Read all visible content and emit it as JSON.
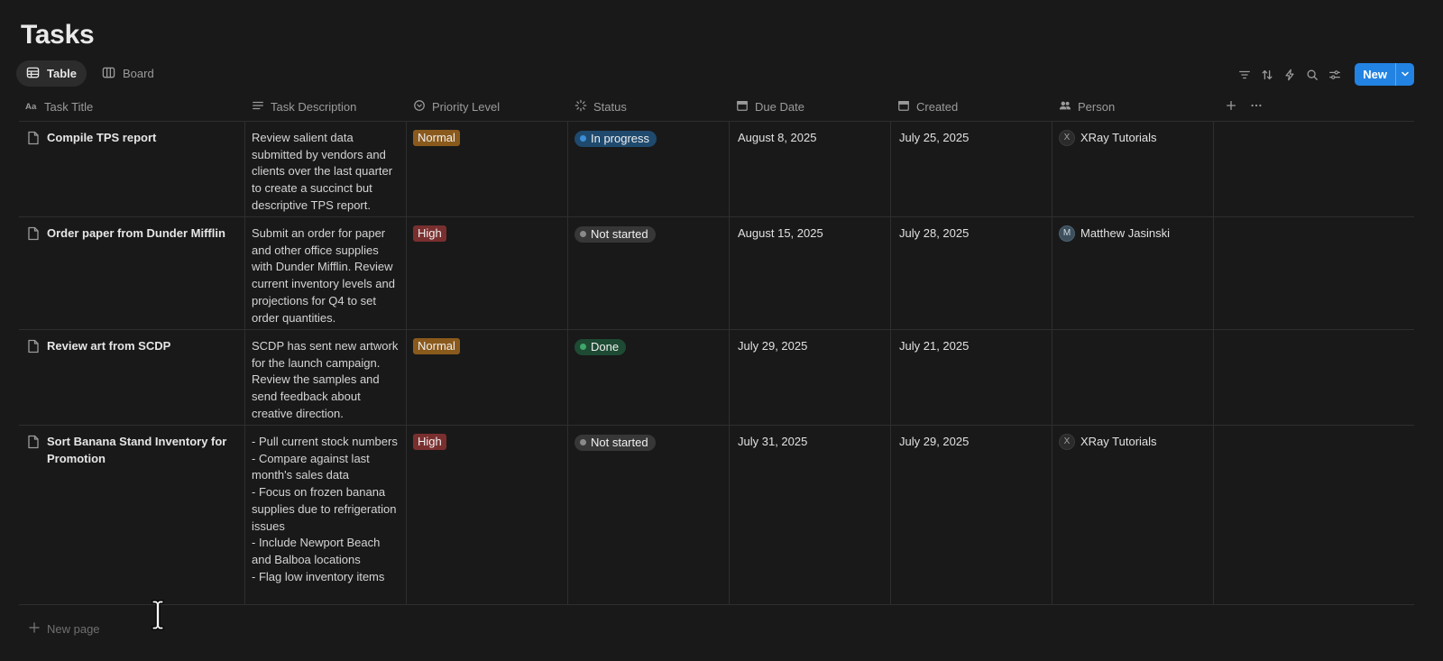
{
  "page": {
    "title": "Tasks"
  },
  "views": [
    {
      "label": "Table",
      "icon": "table-icon",
      "active": true
    },
    {
      "label": "Board",
      "icon": "board-icon",
      "active": false
    }
  ],
  "toolbar": {
    "icons": [
      "filter-icon",
      "sort-icon",
      "automation-icon",
      "search-icon",
      "settings-icon"
    ],
    "new_label": "New",
    "accent": "#2383e2"
  },
  "columns": [
    {
      "label": "Task Title",
      "icon": "text-icon"
    },
    {
      "label": "Task Description",
      "icon": "paragraph-icon"
    },
    {
      "label": "Priority Level",
      "icon": "select-icon"
    },
    {
      "label": "Status",
      "icon": "status-icon"
    },
    {
      "label": "Due Date",
      "icon": "calendar-icon"
    },
    {
      "label": "Created",
      "icon": "calendar-icon"
    },
    {
      "label": "Person",
      "icon": "people-icon"
    }
  ],
  "rows": [
    {
      "title": "Compile TPS report",
      "description": "Review salient data submitted by vendors and clients over the last quarter to create a succinct but descriptive TPS report.",
      "priority": {
        "label": "Normal",
        "color": "#8a5a1c"
      },
      "status": {
        "label": "In progress",
        "bg": "#1f4a6e",
        "dot": "#3b8fd9"
      },
      "due": "August 8, 2025",
      "created": "July 25, 2025",
      "person": {
        "initial": "X",
        "name": "XRay Tutorials"
      }
    },
    {
      "title": "Order paper from Dunder Mifflin",
      "description": "Submit an order for paper and other office supplies with Dunder Mifflin. Review current inventory levels and projections for Q4 to set order quantities.",
      "priority": {
        "label": "High",
        "color": "#7a2f2f"
      },
      "status": {
        "label": "Not started",
        "bg": "#373737",
        "dot": "#8a8a8a"
      },
      "due": "August 15, 2025",
      "created": "July 28, 2025",
      "person": {
        "initial": "M",
        "name": "Matthew Jasinski"
      }
    },
    {
      "title": "Review art from SCDP",
      "description": "SCDP has sent new artwork for the launch campaign. Review the samples and send feedback about creative direction.",
      "priority": {
        "label": "Normal",
        "color": "#8a5a1c"
      },
      "status": {
        "label": "Done",
        "bg": "#1e4a33",
        "dot": "#3ea86a"
      },
      "due": "July 29, 2025",
      "created": "July 21, 2025",
      "person": null
    },
    {
      "title": "Sort Banana Stand Inventory for Promotion",
      "description": "- Pull current stock numbers\n- Compare against last month's sales data\n- Focus on frozen banana supplies due to refrigeration issues\n- Include Newport Beach and Balboa locations\n- Flag low inventory items",
      "priority": {
        "label": "High",
        "color": "#7a2f2f"
      },
      "status": {
        "label": "Not started",
        "bg": "#373737",
        "dot": "#8a8a8a"
      },
      "due": "July 31, 2025",
      "created": "July 29, 2025",
      "person": {
        "initial": "X",
        "name": "XRay Tutorials"
      }
    }
  ],
  "footer": {
    "new_page_label": "New page"
  }
}
